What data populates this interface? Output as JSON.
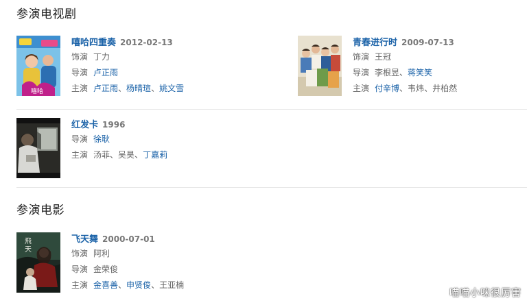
{
  "tv_section": {
    "title": "参演电视剧"
  },
  "movie_section": {
    "title": "参演电影"
  },
  "works": {
    "w1": {
      "title": "嘻哈四重奏",
      "date": "2012-02-13",
      "role_label": "饰演",
      "role": "丁力",
      "director_label": "导演",
      "director": "卢正雨",
      "cast_label": "主演",
      "cast": [
        "卢正雨",
        "杨晴瑄",
        "姚文雪"
      ],
      "sep": "、"
    },
    "w2": {
      "title": "青春进行时",
      "date": "2009-07-13",
      "role_label": "饰演",
      "role": "王冠",
      "director_label": "导演",
      "director": [
        "李根昱",
        "蒋笑笑"
      ],
      "cast_label": "主演",
      "cast": [
        "付辛博",
        "韦炜",
        "井柏然"
      ],
      "sep": "、"
    },
    "w3": {
      "title": "红发卡",
      "date": "1996",
      "director_label": "导演",
      "director": "徐耿",
      "cast_label": "主演",
      "cast": [
        "汤菲",
        "吴昊",
        "丁嘉莉"
      ],
      "sep": "、"
    },
    "w4": {
      "title": "飞天舞",
      "date": "2000-07-01",
      "role_label": "饰演",
      "role": "阿利",
      "director_label": "导演",
      "director": "金荣俊",
      "cast_label": "主演",
      "cast": [
        "金喜善",
        "申贤俊",
        "王亚楠"
      ],
      "sep": "、"
    }
  },
  "watermark": "喵喵小咪很厉害",
  "colors": {
    "link": "#1a62a8",
    "text_gray": "#666666",
    "divider": "#e6e6e6"
  }
}
